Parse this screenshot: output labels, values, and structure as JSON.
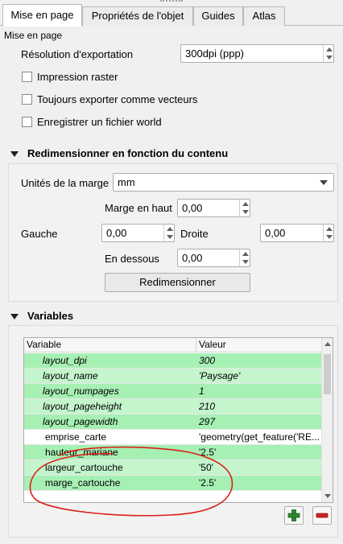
{
  "tabs": [
    {
      "label": "Mise en page",
      "active": true
    },
    {
      "label": "Propriétés de l'objet",
      "active": false
    },
    {
      "label": "Guides",
      "active": false
    },
    {
      "label": "Atlas",
      "active": false
    }
  ],
  "panel_title": "Mise en page",
  "export": {
    "resolution_label": "Résolution d'exportation",
    "resolution_value": "300dpi (ppp)",
    "raster_label": "Impression raster",
    "vector_label": "Toujours exporter comme vecteurs",
    "world_label": "Enregistrer un fichier world"
  },
  "resize": {
    "title": "Redimensionner en fonction du contenu",
    "units_label": "Unités de la marge",
    "units_value": "mm",
    "top_label": "Marge en haut",
    "top_value": "0,00",
    "left_label": "Gauche",
    "left_value": "0,00",
    "right_label": "Droite",
    "right_value": "0,00",
    "bottom_label": "En dessous",
    "bottom_value": "0,00",
    "button_label": "Redimensionner"
  },
  "variables": {
    "title": "Variables",
    "col_variable": "Variable",
    "col_value": "Valeur",
    "rows": [
      {
        "name": "layout_dpi",
        "value": "300",
        "readonly": true
      },
      {
        "name": "layout_name",
        "value": "'Paysage'",
        "readonly": true
      },
      {
        "name": "layout_numpages",
        "value": "1",
        "readonly": true
      },
      {
        "name": "layout_pageheight",
        "value": "210",
        "readonly": true
      },
      {
        "name": "layout_pagewidth",
        "value": "297",
        "readonly": true
      },
      {
        "name": "emprise_carte",
        "value": "'geometry(get_feature('RE...",
        "readonly": false
      },
      {
        "name": "hauteur_mariane",
        "value": "'2.5'",
        "readonly": false
      },
      {
        "name": "largeur_cartouche",
        "value": "'50'",
        "readonly": false
      },
      {
        "name": "marge_cartouche",
        "value": "'2.5'",
        "readonly": false
      }
    ]
  },
  "colors": {
    "readonly_row": "#a7f0b4",
    "custom_row": "#c4f5cd",
    "white_row": "#ffffff",
    "annotation": "#d9201b",
    "add_icon": "#2e8b2e",
    "remove_icon": "#d02020"
  },
  "icons": {
    "add": "plus-icon",
    "remove": "minus-icon"
  }
}
